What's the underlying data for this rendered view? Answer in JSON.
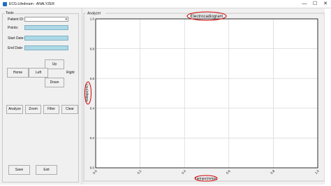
{
  "window": {
    "title": "ECG-Lifedream - ANALYZER",
    "controls": {
      "minimize": "—",
      "maximize": "☐",
      "close": "✕"
    }
  },
  "tools": {
    "group_title": "Tools",
    "patient_id_label": "Patient ID:",
    "patient_id_value": "",
    "points_label": "Points:",
    "points_value": "",
    "start_date_label": "Start Date:",
    "start_date_value": "",
    "end_date_label": "End Date:",
    "end_date_value": ""
  },
  "navigation": {
    "up": "Up",
    "home": "Home",
    "left": "Left",
    "right": "Right",
    "down": "Down"
  },
  "actions": {
    "analyze": "Analyze",
    "zoom": "Zoom",
    "filter": "Filter",
    "clear": "Clear",
    "save": "Save",
    "exit": "Exit"
  },
  "analyzer": {
    "group_title": "Analyzer"
  },
  "chart_data": {
    "type": "line",
    "title": "Electrocadiogram",
    "xlabel": "Tiempo(mmm)",
    "ylabel": "Voltaje(mV)",
    "xlim": [
      0.0,
      1.0
    ],
    "ylim": [
      0.0,
      1.0
    ],
    "x_ticks": [
      "0.0",
      "0.2",
      "0.4",
      "0.6",
      "0.8",
      "1.0"
    ],
    "y_ticks": [
      "0.0",
      "0.2",
      "0.4",
      "0.6",
      "0.8",
      "1.0"
    ],
    "grid": true,
    "series": []
  },
  "colors": {
    "field_fill": "#add8e6",
    "annotation": "#d40000",
    "panel": "#f0f0f0"
  }
}
